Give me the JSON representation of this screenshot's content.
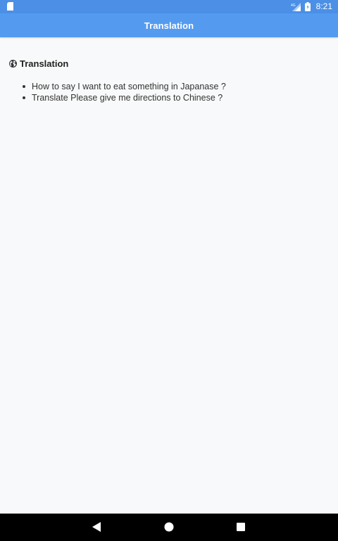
{
  "status_bar": {
    "network_label": "4G",
    "time": "8:21"
  },
  "app_bar": {
    "title": "Translation"
  },
  "section": {
    "icon": "globe-icon",
    "title": "Translation",
    "items": [
      "How to say I want to eat something in Japanase ?",
      "Translate Please give me directions to Chinese ?"
    ]
  },
  "colors": {
    "status_bar": "#4b8fe6",
    "app_bar": "#549bf0",
    "background": "#f8f9fa",
    "nav_bar": "#000000"
  }
}
